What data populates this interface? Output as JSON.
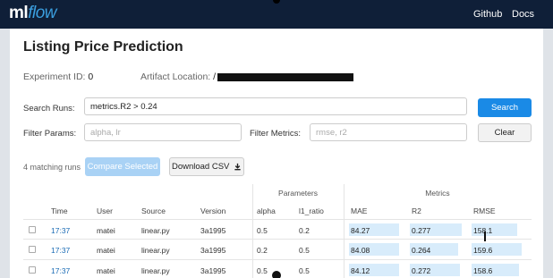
{
  "nav": {
    "logo_ml": "ml",
    "logo_flow": "flow",
    "github": "Github",
    "docs": "Docs"
  },
  "page": {
    "title": "Listing Price Prediction",
    "experiment_id_label": "Experiment ID:",
    "experiment_id": "0",
    "artifact_label": "Artifact Location:",
    "artifact_value": "/"
  },
  "search": {
    "label": "Search Runs:",
    "value": "metrics.R2 > 0.24",
    "button": "Search"
  },
  "filters": {
    "params_label": "Filter Params:",
    "params_placeholder": "alpha, lr",
    "metrics_label": "Filter Metrics:",
    "metrics_placeholder": "rmse, r2",
    "clear": "Clear"
  },
  "actions": {
    "matching": "4 matching runs",
    "compare": "Compare Selected",
    "download": "Download CSV"
  },
  "table": {
    "group_parameters": "Parameters",
    "group_metrics": "Metrics",
    "columns": [
      "Time",
      "User",
      "Source",
      "Version",
      "alpha",
      "l1_ratio",
      "MAE",
      "R2",
      "RMSE"
    ],
    "rows": [
      {
        "time": "17:37",
        "user": "matei",
        "source": "linear.py",
        "version": "3a1995",
        "alpha": "0.5",
        "l1_ratio": "0.2",
        "mae": "84.27",
        "r2": "0.277",
        "rmse": "158.1"
      },
      {
        "time": "17:37",
        "user": "matei",
        "source": "linear.py",
        "version": "3a1995",
        "alpha": "0.2",
        "l1_ratio": "0.5",
        "mae": "84.08",
        "r2": "0.264",
        "rmse": "159.6"
      },
      {
        "time": "17:37",
        "user": "matei",
        "source": "linear.py",
        "version": "3a1995",
        "alpha": "0.5",
        "l1_ratio": "0.5",
        "mae": "84.12",
        "r2": "0.272",
        "rmse": "158.6"
      }
    ]
  },
  "colors": {
    "nav_bg": "#0f1f38",
    "primary": "#1a8ae6",
    "link": "#1a6bb5",
    "metric_bar": "#d8ecfb"
  }
}
